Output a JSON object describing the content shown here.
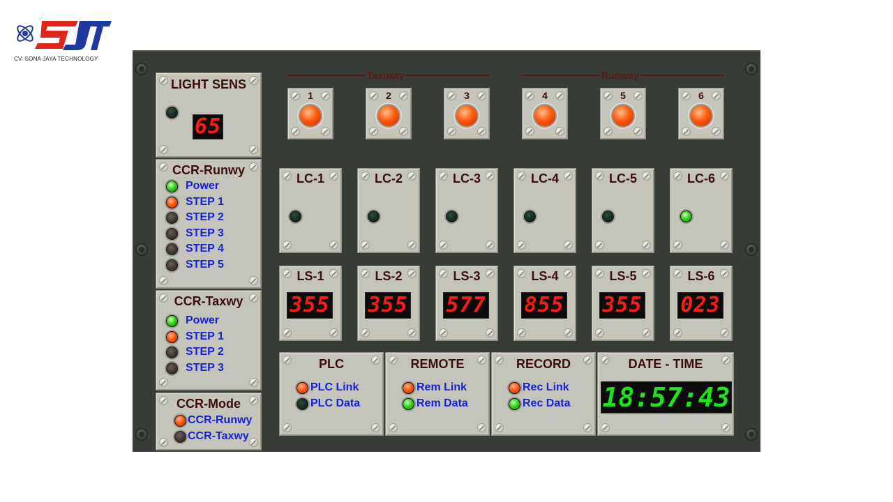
{
  "brand": {
    "logo_text": "SJT",
    "company": "CV. SONA JAYA TECHNOLOGY",
    "colors": {
      "blue": "#1f3a9e",
      "red": "#e0261b"
    }
  },
  "sections": {
    "taxiway": "Taxiway",
    "runway": "Runway"
  },
  "light_sens": {
    "title": "LIGHT SENS",
    "value": "65",
    "led_state": "dark"
  },
  "ccr_runway": {
    "title": "CCR-Runwy",
    "items": [
      {
        "label": "Power",
        "state": "green"
      },
      {
        "label": "STEP 1",
        "state": "red"
      },
      {
        "label": "STEP 2",
        "state": "off"
      },
      {
        "label": "STEP 3",
        "state": "off"
      },
      {
        "label": "STEP 4",
        "state": "off"
      },
      {
        "label": "STEP 5",
        "state": "off"
      }
    ]
  },
  "ccr_taxiway": {
    "title": "CCR-Taxwy",
    "items": [
      {
        "label": "Power",
        "state": "green"
      },
      {
        "label": "STEP 1",
        "state": "red"
      },
      {
        "label": "STEP 2",
        "state": "off"
      },
      {
        "label": "STEP 3",
        "state": "off"
      }
    ]
  },
  "ccr_mode": {
    "title": "CCR-Mode",
    "items": [
      {
        "label": "CCR-Runwy",
        "state": "red"
      },
      {
        "label": "CCR-Taxwy",
        "state": "off"
      }
    ]
  },
  "buttons": [
    "1",
    "2",
    "3",
    "4",
    "5",
    "6"
  ],
  "lc": [
    {
      "label": "LC-1",
      "state": "dark"
    },
    {
      "label": "LC-2",
      "state": "dark"
    },
    {
      "label": "LC-3",
      "state": "dark"
    },
    {
      "label": "LC-4",
      "state": "dark"
    },
    {
      "label": "LC-5",
      "state": "dark"
    },
    {
      "label": "LC-6",
      "state": "green"
    }
  ],
  "ls": [
    {
      "label": "LS-1",
      "value": "355"
    },
    {
      "label": "LS-2",
      "value": "355"
    },
    {
      "label": "LS-3",
      "value": "577"
    },
    {
      "label": "LS-4",
      "value": "855"
    },
    {
      "label": "LS-5",
      "value": "355"
    },
    {
      "label": "LS-6",
      "value": "023"
    }
  ],
  "plc": {
    "title": "PLC",
    "items": [
      {
        "label": "PLC Link",
        "state": "red"
      },
      {
        "label": "PLC Data",
        "state": "dark"
      }
    ]
  },
  "remote": {
    "title": "REMOTE",
    "items": [
      {
        "label": "Rem Link",
        "state": "red"
      },
      {
        "label": "Rem Data",
        "state": "green"
      }
    ]
  },
  "record": {
    "title": "RECORD",
    "items": [
      {
        "label": "Rec Link",
        "state": "red"
      },
      {
        "label": "Rec Data",
        "state": "green"
      }
    ]
  },
  "datetime": {
    "title": "DATE - TIME",
    "value": "18:57:43"
  }
}
